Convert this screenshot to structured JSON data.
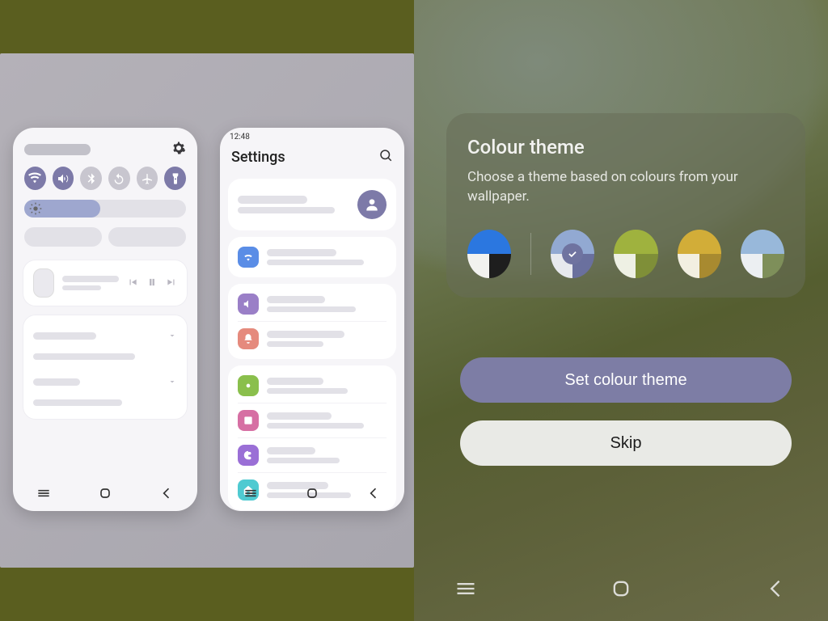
{
  "left": {
    "settings": {
      "time": "12:48",
      "title": "Settings"
    }
  },
  "theme": {
    "title": "Colour theme",
    "subtitle": "Choose a theme based on colours from your wallpaper.",
    "set_btn": "Set colour theme",
    "skip_btn": "Skip",
    "swatches": [
      {
        "id": "wallpaper-default",
        "tricolor": false,
        "top": "#2b77e0",
        "bl": "#f2f2ef",
        "br": "#1e1e1e",
        "selected": false
      },
      {
        "id": "lavender",
        "tricolor": true,
        "top": "#92a9d2",
        "bl": "#e7e9ee",
        "br": "#6a709e",
        "selected": true
      },
      {
        "id": "lime",
        "tricolor": true,
        "top": "#9fb23e",
        "bl": "#eef0e4",
        "br": "#7f8f38",
        "selected": false
      },
      {
        "id": "mustard",
        "tricolor": true,
        "top": "#d2ad38",
        "bl": "#f2efe1",
        "br": "#a88a30",
        "selected": false
      },
      {
        "id": "sky",
        "tricolor": true,
        "top": "#98b8da",
        "bl": "#eceff2",
        "br": "#7e8f5a",
        "selected": false
      }
    ]
  },
  "colors": {
    "accent": "#7d7aa8"
  }
}
